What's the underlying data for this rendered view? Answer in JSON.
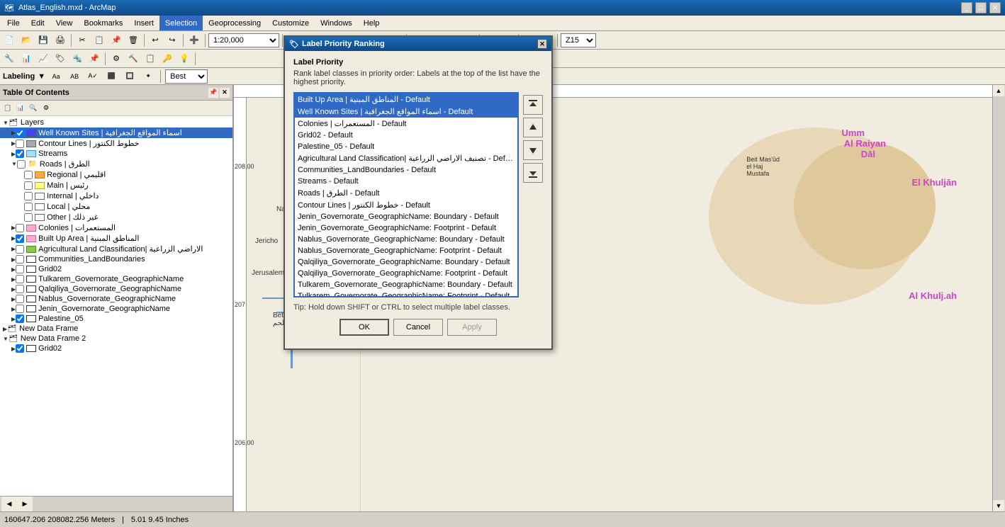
{
  "titlebar": {
    "title": "Atlas_English.mxd - ArcMap",
    "icon": "arcmap-icon",
    "controls": [
      "minimize",
      "maximize",
      "close"
    ]
  },
  "menubar": {
    "items": [
      "File",
      "Edit",
      "View",
      "Bookmarks",
      "Insert",
      "Selection",
      "Geoprocessing",
      "Customize",
      "Windows",
      "Help"
    ]
  },
  "toolbar1": {
    "scale": "1:20,000",
    "zoom_level": "Z15"
  },
  "labeling_toolbar": {
    "label": "Labeling",
    "quality": "Best"
  },
  "toc": {
    "title": "Table Of Contents",
    "layers": [
      {
        "indent": 0,
        "expand": true,
        "checked": null,
        "label": "Layers",
        "type": "group"
      },
      {
        "indent": 1,
        "expand": false,
        "checked": true,
        "label": "Well Known Sites | اسماء المواقع الجغرافية",
        "type": "feature",
        "symbol": "blue"
      },
      {
        "indent": 1,
        "expand": false,
        "checked": false,
        "label": "Contour Lines | خطوط الكنتور",
        "type": "feature",
        "symbol": "gray"
      },
      {
        "indent": 1,
        "expand": false,
        "checked": true,
        "label": "Streams",
        "type": "feature",
        "symbol": "light-blue"
      },
      {
        "indent": 1,
        "expand": true,
        "checked": false,
        "label": "Roads | الطرق",
        "type": "group"
      },
      {
        "indent": 2,
        "expand": false,
        "checked": false,
        "label": "Regional | اقليمي",
        "type": "feature",
        "symbol": "orange"
      },
      {
        "indent": 2,
        "expand": false,
        "checked": false,
        "label": "Main | رئيس",
        "type": "feature",
        "symbol": "yellow"
      },
      {
        "indent": 2,
        "expand": false,
        "checked": false,
        "label": "Internal | داخلي",
        "type": "feature",
        "symbol": "white"
      },
      {
        "indent": 2,
        "expand": false,
        "checked": false,
        "label": "Local | محلي",
        "type": "feature",
        "symbol": "white"
      },
      {
        "indent": 2,
        "expand": false,
        "checked": false,
        "label": "Other | غير ذلك",
        "type": "feature",
        "symbol": "white"
      },
      {
        "indent": 1,
        "expand": false,
        "checked": false,
        "label": "Colonies | المستعمرات",
        "type": "feature",
        "symbol": "pink"
      },
      {
        "indent": 1,
        "expand": false,
        "checked": true,
        "label": "Built Up Area | المناطق المبنية",
        "type": "feature",
        "symbol": "pink"
      },
      {
        "indent": 1,
        "expand": false,
        "checked": false,
        "label": "Agricultural Land Classification| الاراضي الزراعية",
        "type": "feature",
        "symbol": "green"
      },
      {
        "indent": 1,
        "expand": false,
        "checked": false,
        "label": "Communities_LandBoundaries",
        "type": "feature",
        "symbol": "outline"
      },
      {
        "indent": 1,
        "expand": false,
        "checked": false,
        "label": "Grid02",
        "type": "feature",
        "symbol": "outline"
      },
      {
        "indent": 1,
        "expand": false,
        "checked": false,
        "label": "Tulkarem_Governorate_GeographicName",
        "type": "feature",
        "symbol": "outline"
      },
      {
        "indent": 1,
        "expand": false,
        "checked": false,
        "label": "Qalqiliya_Governorate_GeographicName",
        "type": "feature",
        "symbol": "outline"
      },
      {
        "indent": 1,
        "expand": false,
        "checked": false,
        "label": "Nablus_Governorate_GeographicName",
        "type": "feature",
        "symbol": "outline"
      },
      {
        "indent": 1,
        "expand": false,
        "checked": false,
        "label": "Jenin_Governorate_GeographicName",
        "type": "feature",
        "symbol": "outline"
      },
      {
        "indent": 1,
        "expand": false,
        "checked": true,
        "label": "Palestine_05",
        "type": "feature",
        "symbol": "outline"
      },
      {
        "indent": 0,
        "expand": false,
        "checked": null,
        "label": "New Data Frame",
        "type": "dataframe"
      },
      {
        "indent": 0,
        "expand": false,
        "checked": null,
        "label": "New Data Frame 2",
        "type": "dataframe"
      },
      {
        "indent": 1,
        "expand": false,
        "checked": true,
        "label": "Grid02",
        "type": "feature",
        "symbol": "outline"
      }
    ]
  },
  "dialog": {
    "title": "Label Priority Ranking",
    "section_title": "Label Priority",
    "description": "Rank label classes in priority order: Labels at the top of the list have the highest priority.",
    "list_items": [
      {
        "text": "Built Up Area | المناطق المبنية - Default",
        "selected": true
      },
      {
        "text": "Well Known Sites | اسماء المواقع الجغرافية - Default",
        "selected": true
      },
      {
        "text": "Colonies | المستعمرات - Default",
        "selected": false
      },
      {
        "text": "Grid02 - Default",
        "selected": false
      },
      {
        "text": "Palestine_05 - Default",
        "selected": false
      },
      {
        "text": "Agricultural Land Classification| تصنيف الاراضي الزراعية - Default",
        "selected": false
      },
      {
        "text": "Communities_LandBoundaries - Default",
        "selected": false
      },
      {
        "text": "Streams - Default",
        "selected": false
      },
      {
        "text": "Roads | الطرق - Default",
        "selected": false
      },
      {
        "text": "Contour Lines | خطوط الكنتور - Default",
        "selected": false
      },
      {
        "text": "Jenin_Governorate_GeographicName: Boundary - Default",
        "selected": false
      },
      {
        "text": "Jenin_Governorate_GeographicName: Footprint - Default",
        "selected": false
      },
      {
        "text": "Nablus_Governorate_GeographicName: Boundary - Default",
        "selected": false
      },
      {
        "text": "Nablus_Governorate_GeographicName: Footprint - Default",
        "selected": false
      },
      {
        "text": "Qalqiliya_Governorate_GeographicName: Boundary - Default",
        "selected": false
      },
      {
        "text": "Qalqiliya_Governorate_GeographicName: Footprint - Default",
        "selected": false
      },
      {
        "text": "Tulkarem_Governorate_GeographicName: Boundary - Default",
        "selected": false
      },
      {
        "text": "Tulkarem_Governorate_GeographicName: Footprint - Default",
        "selected": false
      }
    ],
    "tip": "Tip: Hold down SHIFT or CTRL to select multiple label classes.",
    "buttons": {
      "ok": "OK",
      "cancel": "Cancel",
      "apply": "Apply"
    },
    "controls": {
      "move_top": "▲▲",
      "move_up": "▲",
      "move_down": "▼",
      "move_bottom": "▼▼"
    }
  },
  "statusbar": {
    "coords": "160647.206  208082.256 Meters",
    "scale_info": "5.01  9.45 Inches"
  }
}
